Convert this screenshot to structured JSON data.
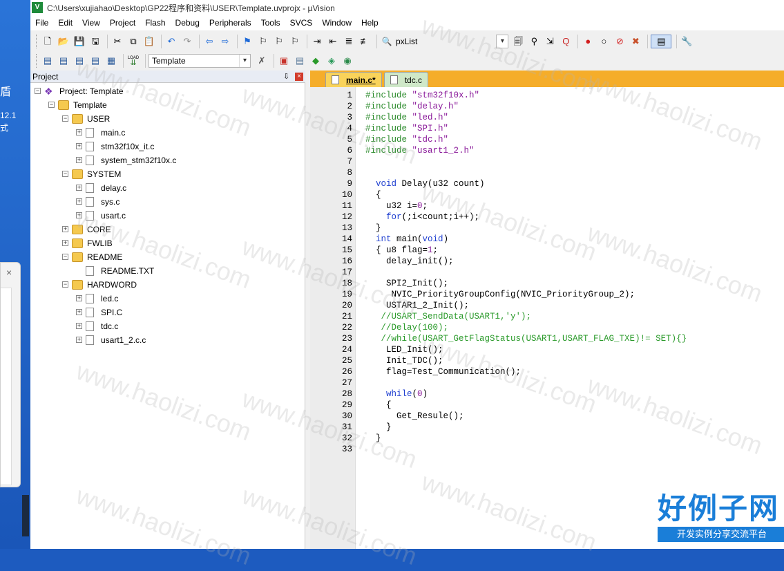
{
  "window": {
    "title": "C:\\Users\\xujiahao\\Desktop\\GP22程序和资料\\USER\\Template.uvprojx - µVision",
    "app_icon": "V"
  },
  "desktop": {
    "glyph": "盾",
    "text1": "12.1",
    "text2": "式",
    "popup_close": "×"
  },
  "menu": [
    "File",
    "Edit",
    "View",
    "Project",
    "Flash",
    "Debug",
    "Peripherals",
    "Tools",
    "SVCS",
    "Window",
    "Help"
  ],
  "toolbar1": {
    "find_combo_value": "pxList",
    "icons": [
      "new-file-icon",
      "open-file-icon",
      "save-icon",
      "save-all-icon",
      "cut-icon",
      "copy-icon",
      "paste-icon",
      "undo-icon",
      "redo-icon",
      "nav-back-icon",
      "nav-forward-icon",
      "bookmark-icon",
      "bookmark-prev-icon",
      "bookmark-next-icon",
      "bookmark-clear-icon",
      "indent-icon",
      "unindent-icon",
      "comment-icon",
      "uncomment-icon",
      "find-in-files-icon",
      "find-icon",
      "incremental-find-icon",
      "debug-start-icon",
      "breakpoint-icon",
      "breakpoint-disable-icon",
      "breakpoint-kill-icon",
      "breakpoint-all-icon",
      "window-layout-icon",
      "configure-icon"
    ]
  },
  "toolbar2": {
    "target_combo_value": "Template",
    "load_label": "LOAD"
  },
  "project_panel": {
    "title": "Project",
    "pin": "⇩",
    "close": "×",
    "tree": [
      {
        "label": "Project: Template",
        "level": 0,
        "type": "project",
        "expander": "−"
      },
      {
        "label": "Template",
        "level": 1,
        "type": "target",
        "expander": "−"
      },
      {
        "label": "USER",
        "level": 2,
        "type": "folder-open",
        "expander": "−"
      },
      {
        "label": "main.c",
        "level": 3,
        "type": "file",
        "expander": "+"
      },
      {
        "label": "stm32f10x_it.c",
        "level": 3,
        "type": "file",
        "expander": "+"
      },
      {
        "label": "system_stm32f10x.c",
        "level": 3,
        "type": "file",
        "expander": "+"
      },
      {
        "label": "SYSTEM",
        "level": 2,
        "type": "folder-open",
        "expander": "−"
      },
      {
        "label": "delay.c",
        "level": 3,
        "type": "file",
        "expander": "+"
      },
      {
        "label": "sys.c",
        "level": 3,
        "type": "file",
        "expander": "+"
      },
      {
        "label": "usart.c",
        "level": 3,
        "type": "file",
        "expander": "+"
      },
      {
        "label": "CORE",
        "level": 2,
        "type": "folder",
        "expander": "+"
      },
      {
        "label": "FWLIB",
        "level": 2,
        "type": "folder",
        "expander": "+"
      },
      {
        "label": "README",
        "level": 2,
        "type": "folder-open",
        "expander": "−"
      },
      {
        "label": "README.TXT",
        "level": 3,
        "type": "file",
        "expander": ""
      },
      {
        "label": "HARDWORD",
        "level": 2,
        "type": "folder-open",
        "expander": "−"
      },
      {
        "label": "led.c",
        "level": 3,
        "type": "file",
        "expander": "+"
      },
      {
        "label": "SPI.C",
        "level": 3,
        "type": "file",
        "expander": "+"
      },
      {
        "label": "tdc.c",
        "level": 3,
        "type": "file",
        "expander": "+"
      },
      {
        "label": "usart1_2.c.c",
        "level": 3,
        "type": "file",
        "expander": "+"
      }
    ]
  },
  "editor": {
    "tabs": [
      {
        "label": "main.c*",
        "active": true
      },
      {
        "label": "tdc.c",
        "active": false
      }
    ],
    "lines": [
      {
        "n": "1",
        "fold": "",
        "tokens": [
          [
            "c-pre",
            "#include "
          ],
          [
            "c-str",
            "\"stm32f10x.h\""
          ]
        ]
      },
      {
        "n": "2",
        "fold": "",
        "tokens": [
          [
            "c-pre",
            "#include "
          ],
          [
            "c-str",
            "\"delay.h\""
          ]
        ]
      },
      {
        "n": "3",
        "fold": "",
        "tokens": [
          [
            "c-pre",
            "#include "
          ],
          [
            "c-str",
            "\"led.h\""
          ]
        ]
      },
      {
        "n": "4",
        "fold": "",
        "tokens": [
          [
            "c-pre",
            "#include "
          ],
          [
            "c-str",
            "\"SPI.h\""
          ]
        ]
      },
      {
        "n": "5",
        "fold": "",
        "tokens": [
          [
            "c-pre",
            "#include "
          ],
          [
            "c-str",
            "\"tdc.h\""
          ]
        ]
      },
      {
        "n": "6",
        "fold": "",
        "tokens": [
          [
            "c-pre",
            "#include "
          ],
          [
            "c-str",
            "\"usart1_2.h\""
          ]
        ]
      },
      {
        "n": "7",
        "fold": "",
        "tokens": []
      },
      {
        "n": "8",
        "fold": "",
        "tokens": []
      },
      {
        "n": "9",
        "fold": "",
        "tokens": [
          [
            "",
            "  "
          ],
          [
            "c-kw",
            "void"
          ],
          [
            "",
            " Delay(u32 count)"
          ]
        ]
      },
      {
        "n": "10",
        "fold": "box",
        "tokens": [
          [
            "",
            "  {"
          ]
        ]
      },
      {
        "n": "11",
        "fold": "line",
        "tokens": [
          [
            "",
            "    u32 i="
          ],
          [
            "c-num",
            "0"
          ],
          [
            "",
            ";"
          ]
        ]
      },
      {
        "n": "12",
        "fold": "line",
        "tokens": [
          [
            "",
            "    "
          ],
          [
            "c-kw",
            "for"
          ],
          [
            "",
            "(;i<count;i++);"
          ]
        ]
      },
      {
        "n": "13",
        "fold": "end",
        "tokens": [
          [
            "",
            "  }"
          ]
        ]
      },
      {
        "n": "14",
        "fold": "",
        "tokens": [
          [
            "",
            "  "
          ],
          [
            "c-kw",
            "int"
          ],
          [
            "",
            " main("
          ],
          [
            "c-kw",
            "void"
          ],
          [
            "",
            ")"
          ]
        ]
      },
      {
        "n": "15",
        "fold": "box",
        "tokens": [
          [
            "",
            "  { u8 flag="
          ],
          [
            "c-num",
            "1"
          ],
          [
            "",
            ";"
          ]
        ]
      },
      {
        "n": "16",
        "fold": "line",
        "tokens": [
          [
            "",
            "    delay_init();"
          ]
        ]
      },
      {
        "n": "17",
        "fold": "line",
        "tokens": []
      },
      {
        "n": "18",
        "fold": "line",
        "tokens": [
          [
            "",
            "    SPI2_Init();"
          ]
        ]
      },
      {
        "n": "19",
        "fold": "line",
        "tokens": [
          [
            "",
            "     NVIC_PriorityGroupConfig(NVIC_PriorityGroup_2);"
          ]
        ]
      },
      {
        "n": "20",
        "fold": "line",
        "tokens": [
          [
            "",
            "    USTAR1_2_Init();"
          ]
        ]
      },
      {
        "n": "21",
        "fold": "line",
        "tokens": [
          [
            "c-cm",
            "   //USART_SendData(USART1,'y');"
          ]
        ]
      },
      {
        "n": "22",
        "fold": "line",
        "tokens": [
          [
            "c-cm",
            "   //Delay(100);"
          ]
        ]
      },
      {
        "n": "23",
        "fold": "line",
        "tokens": [
          [
            "c-cm",
            "   //while(USART_GetFlagStatus(USART1,USART_FLAG_TXE)!= SET){}"
          ]
        ]
      },
      {
        "n": "24",
        "fold": "line",
        "tokens": [
          [
            "",
            "    LED_Init();"
          ]
        ]
      },
      {
        "n": "25",
        "fold": "line",
        "tokens": [
          [
            "",
            "    Init_TDC();"
          ]
        ]
      },
      {
        "n": "26",
        "fold": "line",
        "tokens": [
          [
            "",
            "    flag=Test_Communication();"
          ]
        ]
      },
      {
        "n": "27",
        "fold": "line",
        "tokens": []
      },
      {
        "n": "28",
        "fold": "line",
        "tokens": [
          [
            "",
            "    "
          ],
          [
            "c-kw",
            "while"
          ],
          [
            "",
            "("
          ],
          [
            "c-num",
            "0"
          ],
          [
            "",
            ")"
          ]
        ]
      },
      {
        "n": "29",
        "fold": "box",
        "tokens": [
          [
            "",
            "    {"
          ]
        ]
      },
      {
        "n": "30",
        "fold": "line",
        "tokens": [
          [
            "",
            "      Get_Resule();"
          ]
        ]
      },
      {
        "n": "31",
        "fold": "end",
        "tokens": [
          [
            "",
            "    }"
          ]
        ]
      },
      {
        "n": "32",
        "fold": "end",
        "tokens": [
          [
            "",
            "  }"
          ]
        ]
      },
      {
        "n": "33",
        "fold": "",
        "tokens": []
      }
    ]
  },
  "watermark": {
    "text": "www.haolizi.com"
  },
  "logo": {
    "main": "好例子网",
    "sub": "开发实例分享交流平台"
  },
  "colors": {
    "tab_strip": "#f5ad2a",
    "active_tab": "#f9d35a",
    "inactive_tab": "#cfe8c8",
    "preprocessor": "#2a8a2a",
    "string": "#8a1a9a",
    "keyword": "#1f3fd0",
    "comment": "#2a9a2a",
    "logo_blue": "#1a7ed8"
  }
}
